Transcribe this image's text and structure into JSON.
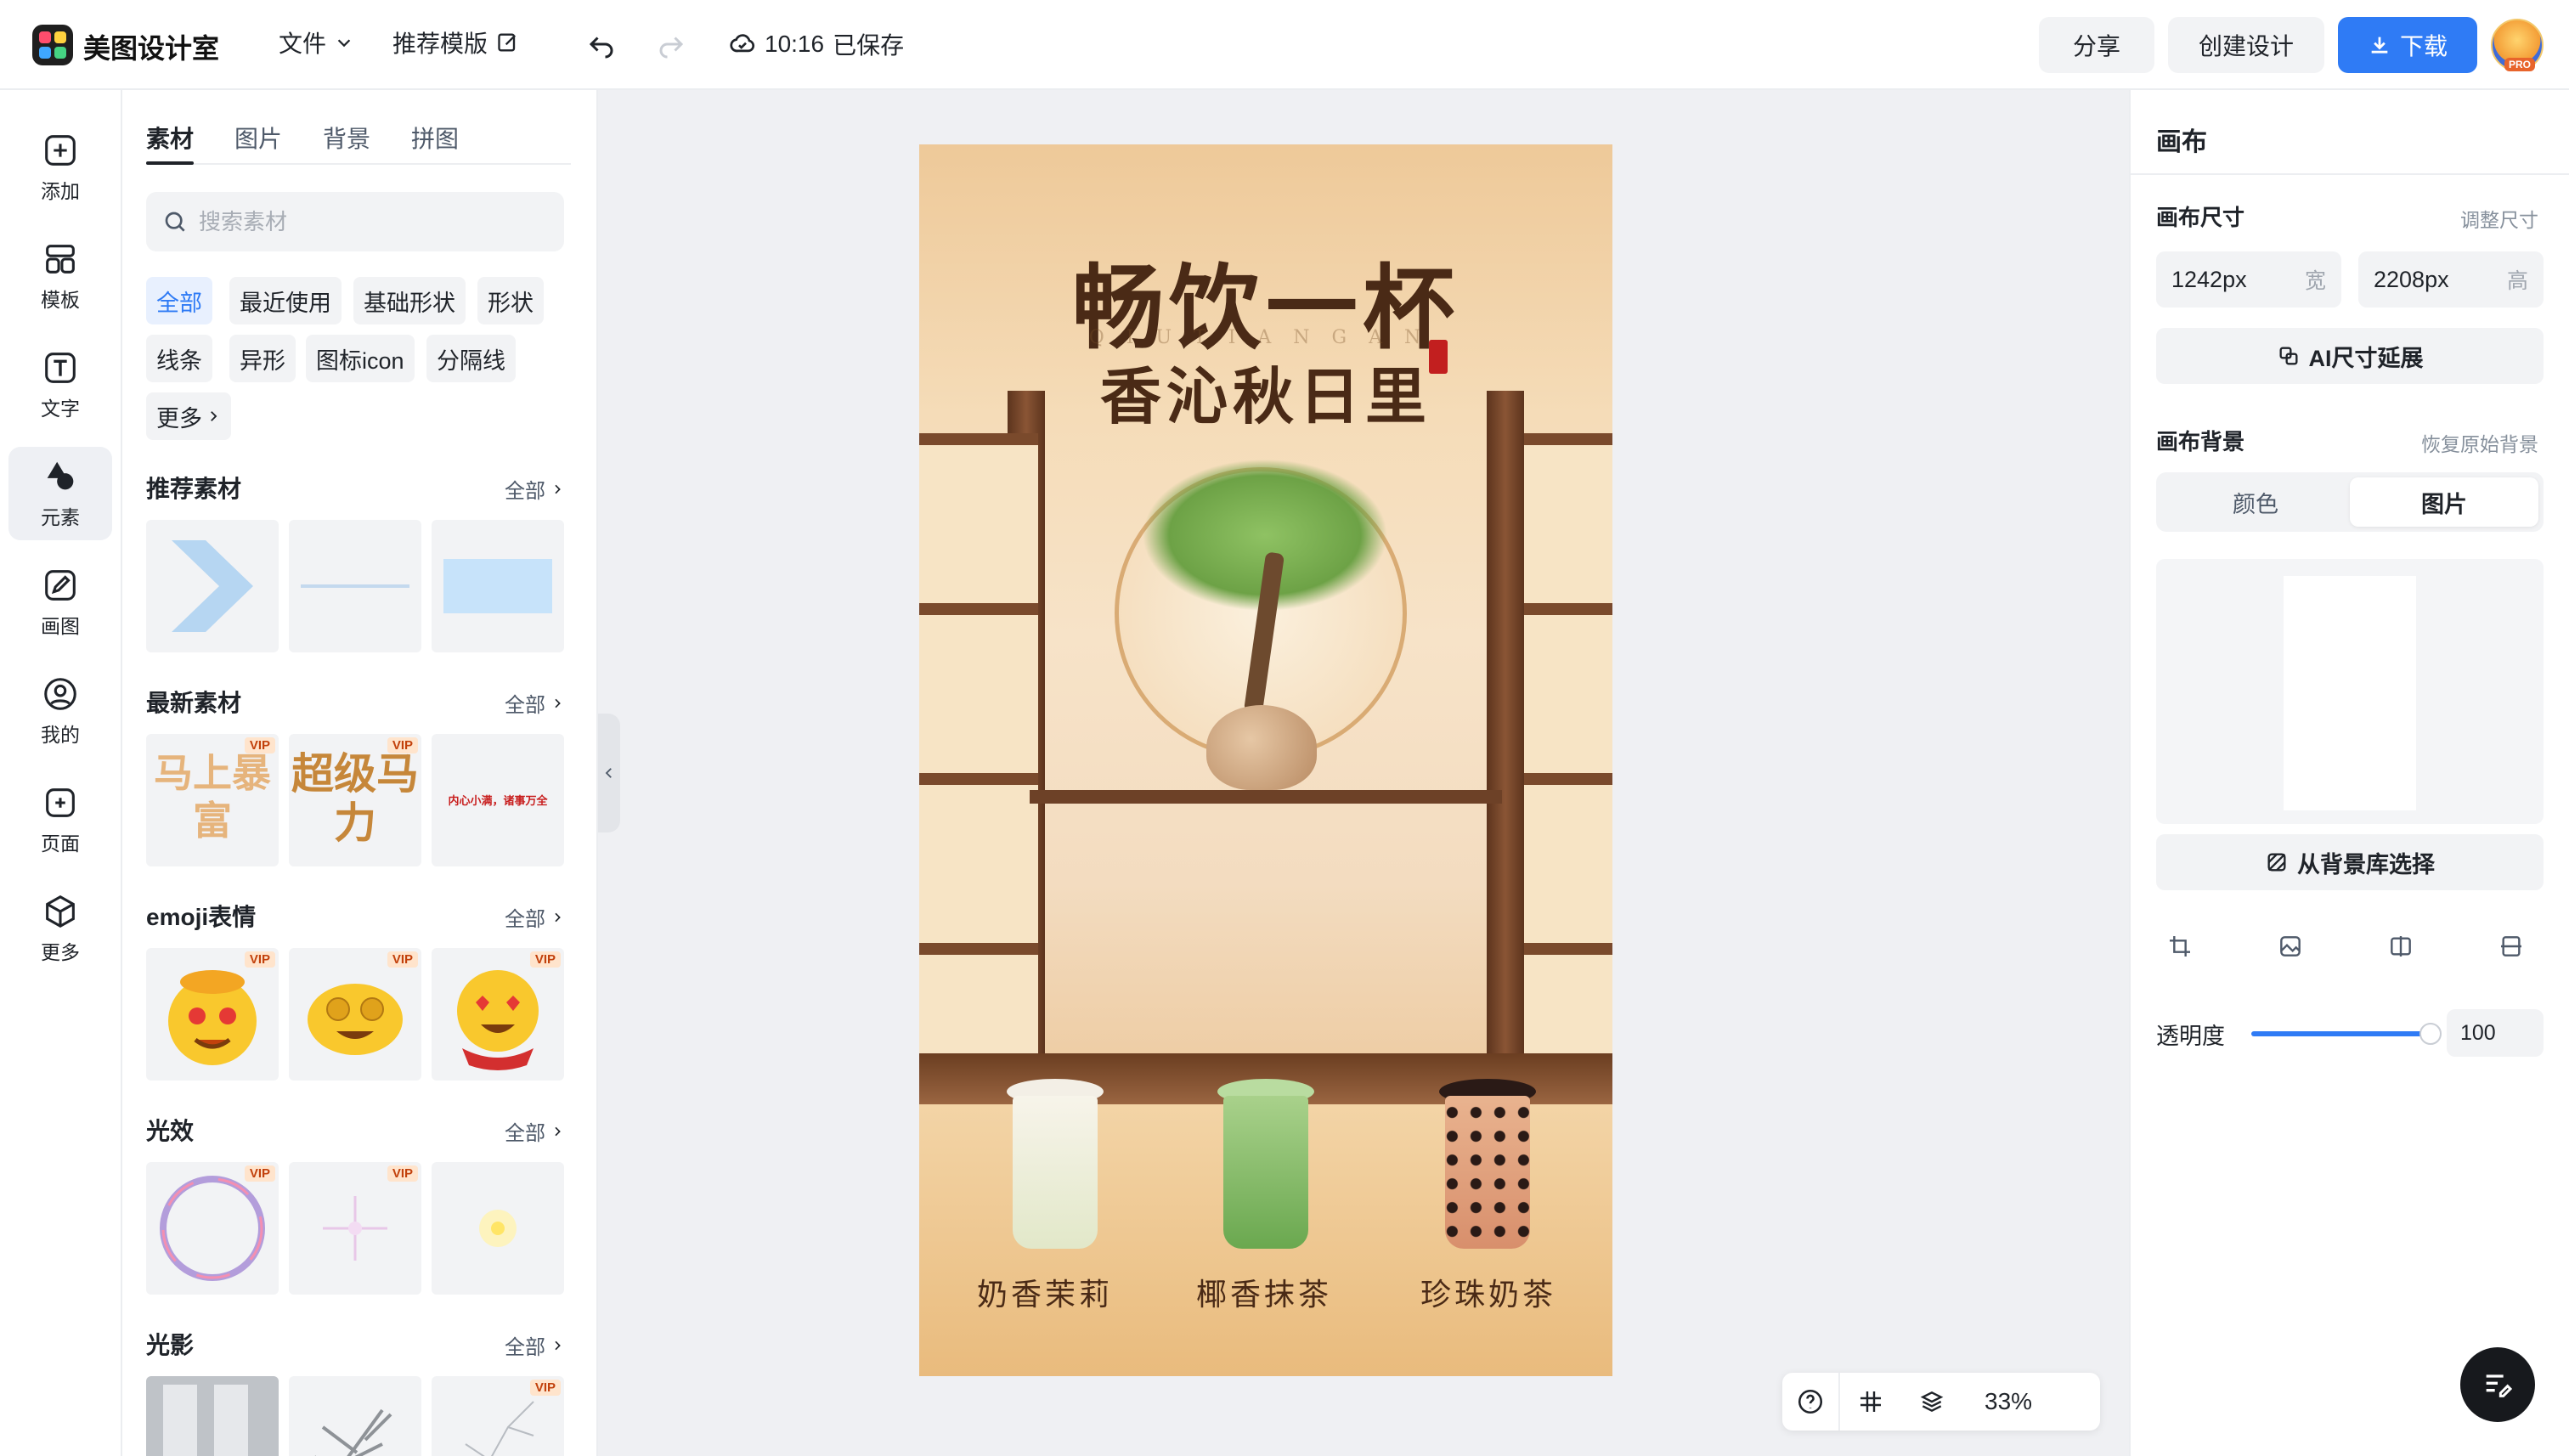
{
  "app": {
    "brand": "美图设计室",
    "menu_file": "文件",
    "menu_template": "推荐模版",
    "save_time": "10:16",
    "save_status": "已保存",
    "share_label": "分享",
    "create_label": "创建设计",
    "download_label": "下载",
    "pro_badge": "PRO",
    "accent_color": "#2f7bf5"
  },
  "leftnav": {
    "items": [
      {
        "label": "添加",
        "icon": "plus-square-icon"
      },
      {
        "label": "模板",
        "icon": "layout-icon"
      },
      {
        "label": "文字",
        "icon": "text-icon"
      },
      {
        "label": "元素",
        "icon": "shapes-icon"
      },
      {
        "label": "画图",
        "icon": "pen-icon"
      },
      {
        "label": "我的",
        "icon": "user-icon"
      },
      {
        "label": "页面",
        "icon": "page-add-icon"
      },
      {
        "label": "更多",
        "icon": "cube-icon"
      }
    ],
    "active": "元素"
  },
  "panel": {
    "tabs": [
      "素材",
      "图片",
      "背景",
      "拼图"
    ],
    "active_tab": "素材",
    "search_placeholder": "搜索素材",
    "chips": [
      "全部",
      "最近使用",
      "基础形状",
      "形状",
      "线条",
      "异形",
      "图标icon",
      "分隔线",
      "更多"
    ],
    "sections": [
      {
        "title": "推荐素材",
        "more": "全部"
      },
      {
        "title": "最新素材",
        "more": "全部",
        "tile_texts": [
          "马上暴富",
          "超级马力",
          "内心小满，诸事万全"
        ]
      },
      {
        "title": "emoji表情",
        "more": "全部"
      },
      {
        "title": "光效",
        "more": "全部"
      },
      {
        "title": "光影",
        "more": "全部"
      }
    ],
    "vip_label": "VIP"
  },
  "poster": {
    "title": "畅饮一杯",
    "subtitle": "香沁秋日里",
    "pinyin": "QIUTIANGAN",
    "drinks": [
      "奶香茉莉",
      "椰香抹茶",
      "珍珠奶茶"
    ]
  },
  "canvas_tools": {
    "zoom": "33%"
  },
  "right_panel": {
    "title": "画布",
    "size_label": "画布尺寸",
    "resize_link": "调整尺寸",
    "width_value": "1242px",
    "width_unit": "宽",
    "height_value": "2208px",
    "height_unit": "高",
    "ai_extend_label": "AI尺寸延展",
    "bg_label": "画布背景",
    "restore_link": "恢复原始背景",
    "bg_tabs": [
      "颜色",
      "图片"
    ],
    "bg_active": "图片",
    "library_label": "从背景库选择",
    "opacity_label": "透明度",
    "opacity_value": "100"
  }
}
